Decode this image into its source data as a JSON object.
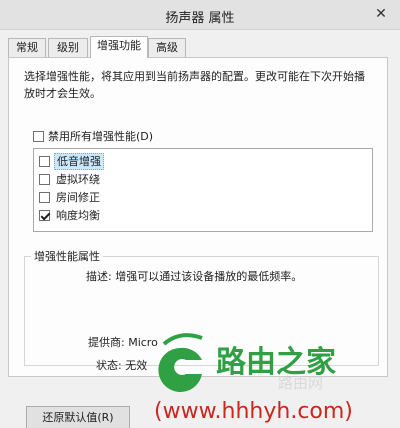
{
  "window": {
    "title": "扬声器 属性",
    "close_glyph": "✕"
  },
  "tabs": [
    {
      "label": "常规"
    },
    {
      "label": "级别"
    },
    {
      "label": "增强功能",
      "active": true
    },
    {
      "label": "高级"
    }
  ],
  "intro_text": "选择增强性能，将其应用到当前扬声器的配置。更改可能在下次开始播放时才会生效。",
  "disable_all": {
    "label": "禁用所有增强性能(D)",
    "checked": false
  },
  "enhancements": [
    {
      "label": "低音增强",
      "checked": false,
      "selected": true
    },
    {
      "label": "虚拟环绕",
      "checked": false,
      "selected": false
    },
    {
      "label": "房间修正",
      "checked": false,
      "selected": false
    },
    {
      "label": "响度均衡",
      "checked": true,
      "selected": false
    }
  ],
  "properties": {
    "title": "增强性能属性",
    "description": "描述: 增强可以通过该设备播放的最低频率。",
    "provider": "提供商: Micro",
    "status": "状态: 无效"
  },
  "reset_button": {
    "label": "还原默认值(R)"
  },
  "watermark": {
    "brand": "路由之家",
    "url": "(www.hhhyh.com)",
    "faint": "路由网"
  },
  "colors": {
    "watermark_green": "#2fa044",
    "watermark_red": "#c8281e"
  }
}
